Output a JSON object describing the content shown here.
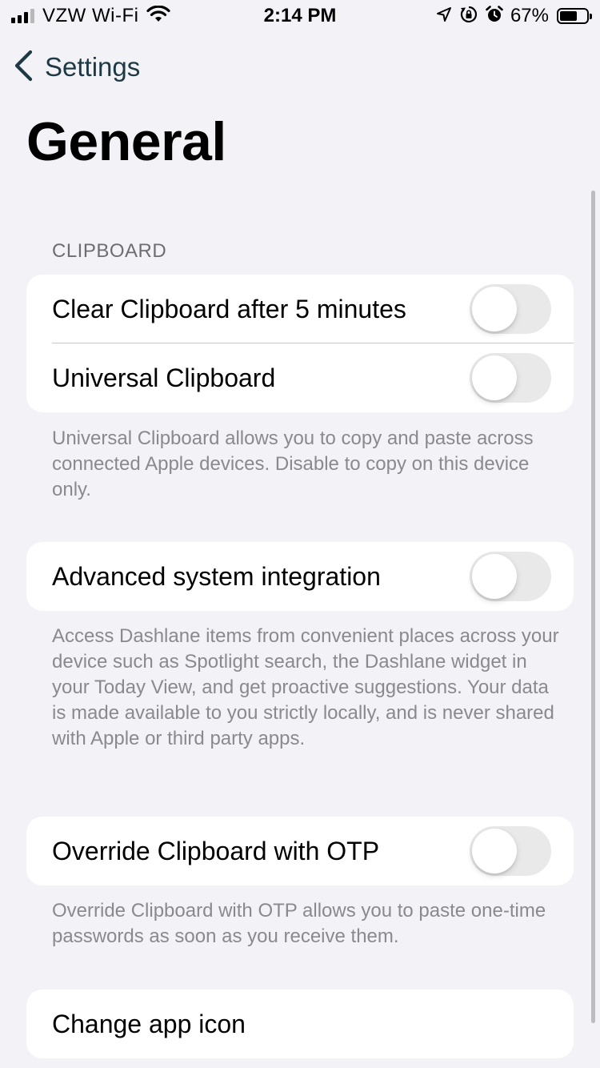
{
  "status_bar": {
    "carrier": "VZW Wi-Fi",
    "time": "2:14 PM",
    "battery": "67%",
    "battery_level": 0.67,
    "icons": [
      "signal-icon",
      "wifi-icon",
      "location-icon",
      "orientation-lock-icon",
      "alarm-icon",
      "battery-icon"
    ]
  },
  "nav": {
    "back_label": "Settings"
  },
  "page": {
    "title": "General"
  },
  "clipboard_section": {
    "header": "CLIPBOARD",
    "rows": [
      {
        "label": "Clear Clipboard after 5 minutes",
        "on": false
      },
      {
        "label": "Universal Clipboard",
        "on": false
      }
    ],
    "footer": "Universal Clipboard allows you to copy and paste across connected Apple devices. Disable to copy on this device only."
  },
  "integration_section": {
    "row_label": "Advanced system integration",
    "on": false,
    "footer": "Access Dashlane items from convenient places across your device such as Spotlight search, the Dashlane widget in your Today View, and get proactive suggestions. Your data is made available to you strictly locally, and is never shared with Apple or third party apps."
  },
  "otp_section": {
    "row_label": "Override Clipboard with OTP",
    "on": false,
    "footer": "Override Clipboard with OTP allows you to paste one-time passwords as soon as you receive them."
  },
  "app_icon_section": {
    "row_label": "Change app icon"
  },
  "colors": {
    "background": "#f2f2f7",
    "toggle_off": "#e9e9ea",
    "back_link": "#1d3a44",
    "footer_text": "#8a8a8e"
  }
}
